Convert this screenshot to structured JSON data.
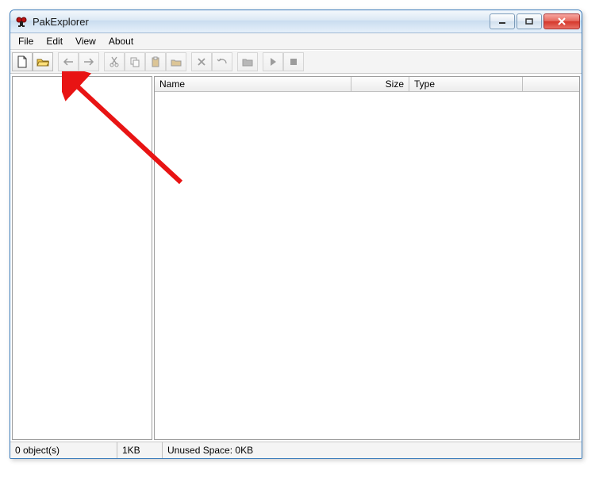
{
  "window": {
    "title": "PakExplorer"
  },
  "menubar": {
    "items": [
      "File",
      "Edit",
      "View",
      "About"
    ]
  },
  "toolbar": {
    "buttons": [
      {
        "name": "new-file-icon",
        "enabled": true
      },
      {
        "name": "open-folder-icon",
        "enabled": true
      },
      {
        "sep": true
      },
      {
        "name": "back-arrow-icon",
        "enabled": false
      },
      {
        "name": "forward-arrow-icon",
        "enabled": false
      },
      {
        "sep": true
      },
      {
        "name": "cut-icon",
        "enabled": false
      },
      {
        "name": "copy-icon",
        "enabled": false
      },
      {
        "name": "paste-icon",
        "enabled": false
      },
      {
        "name": "folder-paste-icon",
        "enabled": false
      },
      {
        "sep": true
      },
      {
        "name": "delete-icon",
        "enabled": false
      },
      {
        "name": "undo-icon",
        "enabled": false
      },
      {
        "sep": true
      },
      {
        "name": "folder-icon",
        "enabled": false
      },
      {
        "sep": true
      },
      {
        "name": "play-icon",
        "enabled": false
      },
      {
        "name": "stop-icon",
        "enabled": false
      }
    ]
  },
  "columns": {
    "name": "Name",
    "size": "Size",
    "type": "Type"
  },
  "statusbar": {
    "objects": "0 object(s)",
    "size": "1KB",
    "unused": "Unused Space:  0KB"
  }
}
